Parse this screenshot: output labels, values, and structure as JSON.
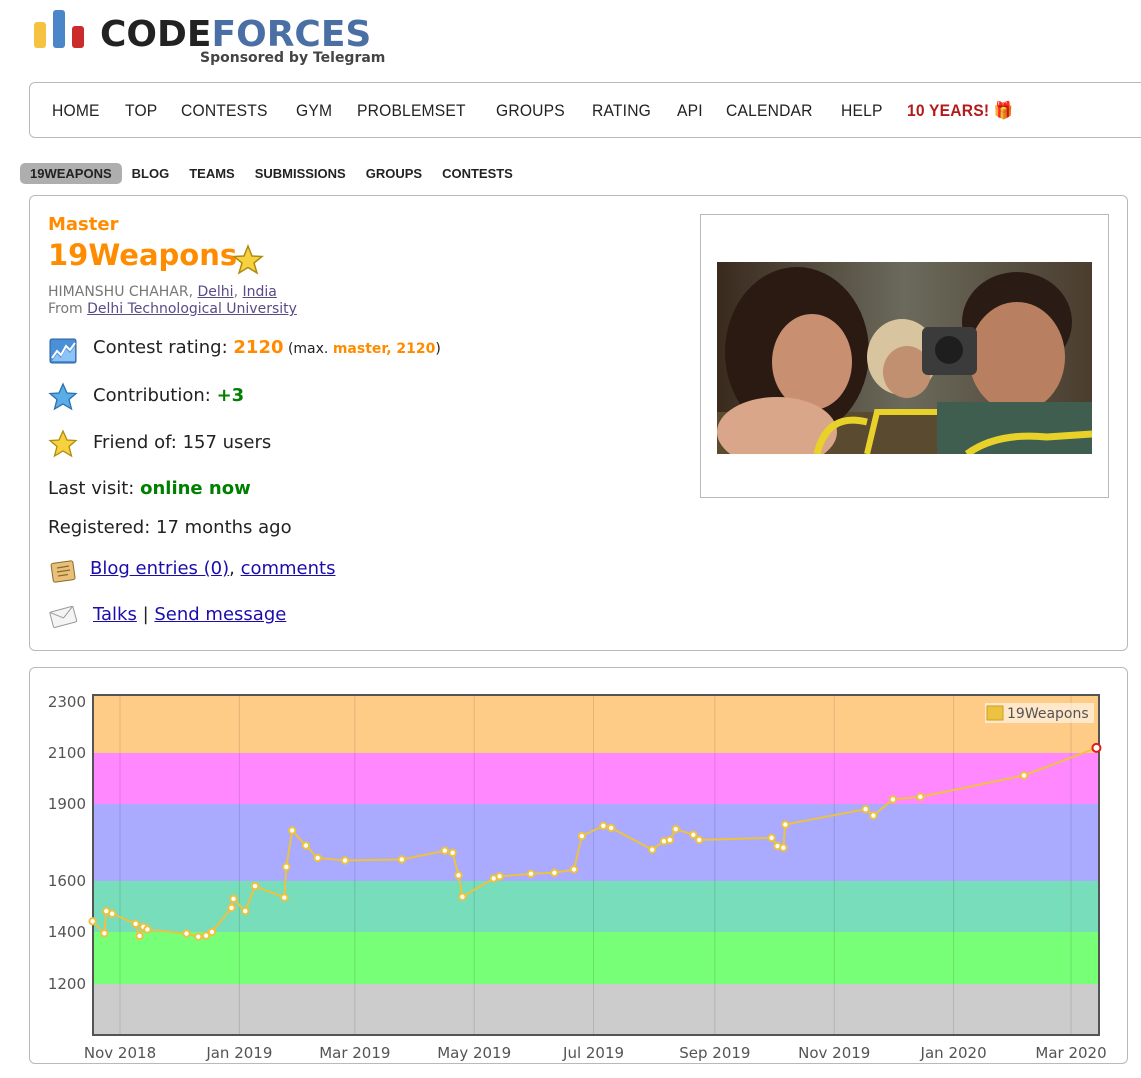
{
  "logo": {
    "word_dark": "CODE",
    "word_blue": "FORCES",
    "subtitle": "Sponsored by Telegram",
    "bar_colors": [
      "#f5c242",
      "#4a86c8",
      "#cc2b2b"
    ]
  },
  "menu": {
    "items": [
      "HOME",
      "TOP",
      "CONTESTS",
      "GYM",
      "PROBLEMSET",
      "GROUPS",
      "RATING",
      "API",
      "CALENDAR",
      "HELP"
    ],
    "special": "10 YEARS! 🎁"
  },
  "submenu": {
    "items": [
      "19WEAPONS",
      "BLOG",
      "TEAMS",
      "SUBMISSIONS",
      "GROUPS",
      "CONTESTS"
    ],
    "active": "19WEAPONS"
  },
  "profile": {
    "rank": "Master",
    "handle": "19Weapons",
    "real_name": "HIMANSHU CHAHAR, ",
    "city": "Delhi",
    "sep": ", ",
    "country": "India",
    "from_label": "From ",
    "university": "Delhi Technological University",
    "contest_rating_label": "Contest rating: ",
    "contest_rating": "2120",
    "max_open": " (max. ",
    "max_value": "master, 2120",
    "max_close": ")",
    "contribution_label": "Contribution: ",
    "contribution": "+3",
    "friend_label": "Friend of: 157 users",
    "last_visit_label": "Last visit: ",
    "last_visit": "online now",
    "registered": "Registered: 17 months ago",
    "blog_entries": "Blog entries (0)",
    "comma": ", ",
    "comments": "comments",
    "talks": "Talks",
    "pipe": " | ",
    "send_message": "Send message",
    "icons": [
      "rating-chart-icon",
      "contribution-star-icon",
      "friend-star-icon",
      "blog-scroll-icon",
      "talks-envelope-icon"
    ]
  },
  "chart_data": {
    "type": "line",
    "series": [
      {
        "name": "19Weapons",
        "color": "#edc240"
      }
    ],
    "ylim": [
      1000,
      2330
    ],
    "yticks": [
      1200,
      1400,
      1600,
      1900,
      2100,
      2300
    ],
    "xticks": [
      "Nov 2018",
      "Jan 2019",
      "Mar 2019",
      "May 2019",
      "Jul 2019",
      "Sep 2019",
      "Nov 2019",
      "Jan 2020",
      "Mar 2020"
    ],
    "xtick_dates": [
      "2018-11-01",
      "2019-01-01",
      "2019-03-01",
      "2019-05-01",
      "2019-07-01",
      "2019-09-01",
      "2019-11-01",
      "2020-01-01",
      "2020-03-01"
    ],
    "bands": [
      {
        "from": 1000,
        "to": 1200,
        "color": "#cccccc"
      },
      {
        "from": 1200,
        "to": 1400,
        "color": "#77ff77"
      },
      {
        "from": 1400,
        "to": 1600,
        "color": "#77ddbb"
      },
      {
        "from": 1600,
        "to": 1900,
        "color": "#aaaaff"
      },
      {
        "from": 1900,
        "to": 2100,
        "color": "#ff88ff"
      },
      {
        "from": 2100,
        "to": 2330,
        "color": "#ffcc88"
      }
    ],
    "points": [
      {
        "x": "2018-10-18",
        "y": 1442
      },
      {
        "x": "2018-10-24",
        "y": 1395
      },
      {
        "x": "2018-10-25",
        "y": 1482
      },
      {
        "x": "2018-10-28",
        "y": 1472
      },
      {
        "x": "2018-11-09",
        "y": 1432
      },
      {
        "x": "2018-11-11",
        "y": 1385
      },
      {
        "x": "2018-11-13",
        "y": 1420
      },
      {
        "x": "2018-11-15",
        "y": 1410
      },
      {
        "x": "2018-12-05",
        "y": 1394
      },
      {
        "x": "2018-12-11",
        "y": 1382
      },
      {
        "x": "2018-12-15",
        "y": 1386
      },
      {
        "x": "2018-12-18",
        "y": 1400
      },
      {
        "x": "2018-12-28",
        "y": 1495
      },
      {
        "x": "2018-12-29",
        "y": 1530
      },
      {
        "x": "2019-01-04",
        "y": 1482
      },
      {
        "x": "2019-01-09",
        "y": 1580
      },
      {
        "x": "2019-01-24",
        "y": 1535
      },
      {
        "x": "2019-01-25",
        "y": 1655
      },
      {
        "x": "2019-01-28",
        "y": 1797
      },
      {
        "x": "2019-02-04",
        "y": 1738
      },
      {
        "x": "2019-02-10",
        "y": 1690
      },
      {
        "x": "2019-02-24",
        "y": 1680
      },
      {
        "x": "2019-03-25",
        "y": 1684
      },
      {
        "x": "2019-04-16",
        "y": 1718
      },
      {
        "x": "2019-04-20",
        "y": 1710
      },
      {
        "x": "2019-04-23",
        "y": 1622
      },
      {
        "x": "2019-04-25",
        "y": 1538
      },
      {
        "x": "2019-05-11",
        "y": 1610
      },
      {
        "x": "2019-05-14",
        "y": 1618
      },
      {
        "x": "2019-05-30",
        "y": 1628
      },
      {
        "x": "2019-06-11",
        "y": 1632
      },
      {
        "x": "2019-06-21",
        "y": 1645
      },
      {
        "x": "2019-06-25",
        "y": 1775
      },
      {
        "x": "2019-07-06",
        "y": 1815
      },
      {
        "x": "2019-07-10",
        "y": 1807
      },
      {
        "x": "2019-07-31",
        "y": 1722
      },
      {
        "x": "2019-08-06",
        "y": 1755
      },
      {
        "x": "2019-08-09",
        "y": 1760
      },
      {
        "x": "2019-08-12",
        "y": 1802
      },
      {
        "x": "2019-08-21",
        "y": 1780
      },
      {
        "x": "2019-08-24",
        "y": 1760
      },
      {
        "x": "2019-09-30",
        "y": 1768
      },
      {
        "x": "2019-10-03",
        "y": 1736
      },
      {
        "x": "2019-10-06",
        "y": 1730
      },
      {
        "x": "2019-10-07",
        "y": 1820
      },
      {
        "x": "2019-11-17",
        "y": 1880
      },
      {
        "x": "2019-11-21",
        "y": 1855
      },
      {
        "x": "2019-12-01",
        "y": 1918
      },
      {
        "x": "2019-12-15",
        "y": 1928
      },
      {
        "x": "2020-02-06",
        "y": 2012
      },
      {
        "x": "2020-03-14",
        "y": 2120
      }
    ]
  }
}
